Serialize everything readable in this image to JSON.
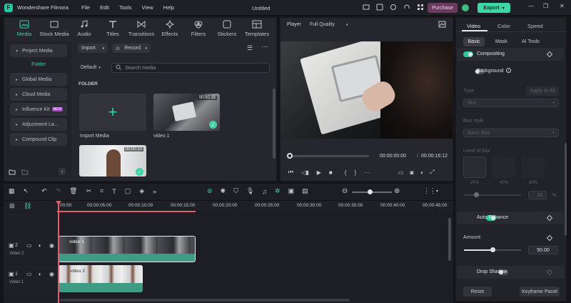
{
  "app": {
    "name": "Wondershare Filmora",
    "project_title": "Untitled"
  },
  "menu": [
    "File",
    "Edit",
    "Tools",
    "View",
    "Help"
  ],
  "header_actions": {
    "purchase": "Purchase",
    "export": "Export"
  },
  "media_tabs": [
    "Media",
    "Stock Media",
    "Audio",
    "Titles",
    "Transitions",
    "Effects",
    "Filters",
    "Stickers",
    "Templates"
  ],
  "sidebar": {
    "items": [
      {
        "label": "Project Media",
        "expanded": true
      },
      {
        "label": "Folder",
        "selected": true
      },
      {
        "label": "Global Media"
      },
      {
        "label": "Cloud Media"
      },
      {
        "label": "Influence Kit",
        "badge": "NEW"
      },
      {
        "label": "Adjustment La..."
      },
      {
        "label": "Compound Clip"
      }
    ]
  },
  "media_toolbar": {
    "import": "Import",
    "record": "Record",
    "sort": "Default",
    "search_placeholder": "Search media",
    "folder_label": "FOLDER"
  },
  "media_items": [
    {
      "label": "Import Media",
      "type": "import"
    },
    {
      "label": "video 1",
      "duration": "00:00:16",
      "type": "video"
    },
    {
      "label": "",
      "duration": "00:00:10",
      "type": "video"
    }
  ],
  "player": {
    "tab": "Player",
    "quality": "Full Quality",
    "current_time": "00:00:00:00",
    "total_time": "00:00:16:12",
    "progress": 0.0
  },
  "timeline": {
    "ruler": [
      "00:00",
      "00:00:05:00",
      "00:00:10:00",
      "00:00:15:00",
      "00:00:20:00",
      "00:00:25:00",
      "00:00:30:00",
      "00:00:35:00",
      "00:00:40:00",
      "00:00:45:00"
    ],
    "tracks": [
      {
        "index": "2",
        "label": "Video 2",
        "clip": "video 1"
      },
      {
        "index": "1",
        "label": "Video 1",
        "clip": "video 2"
      }
    ]
  },
  "properties": {
    "tabs": [
      "Video",
      "Color",
      "Speed"
    ],
    "subtabs": [
      "Basic",
      "Mask",
      "AI Tools"
    ],
    "compositing": "Compositing",
    "background": "Background",
    "type_label": "Type",
    "apply_all": "Apply to All",
    "type_value": "Blur",
    "blur_style_label": "Blur style",
    "blur_style_value": "Basic Blur",
    "level_label": "Level of blur",
    "blur_levels": [
      "20%",
      "40%",
      "60%"
    ],
    "blur_amount": "20",
    "blur_unit": "%",
    "auto_enhance": "Auto Enhance",
    "amount_label": "Amount",
    "amount_value": "50.00",
    "amount_fraction": 0.5,
    "drop_shadow": "Drop Shadow",
    "reset": "Reset",
    "keyframe_panel": "Keyframe Panel"
  },
  "colors": {
    "accent": "#2ec79d",
    "purchase": "#7a3f6e",
    "export": "#3fd6a6",
    "clip": "#3d9c83"
  }
}
